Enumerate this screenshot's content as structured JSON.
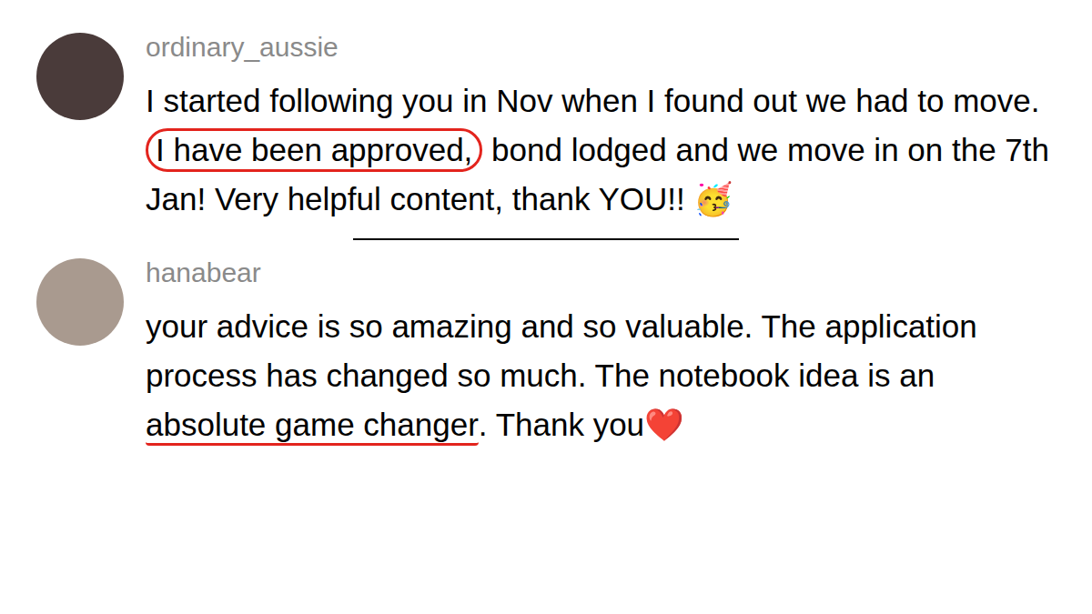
{
  "comments": [
    {
      "username": "ordinary_aussie",
      "segments": [
        {
          "text": "I started following you in Nov when I found out we had to move. ",
          "annotation": "none"
        },
        {
          "text": "I have been approved,",
          "annotation": "circle"
        },
        {
          "text": " bond lodged and we move in on the 7th Jan! Very helpful content, thank YOU!! 🥳",
          "annotation": "none"
        }
      ]
    },
    {
      "username": "hanabear",
      "segments": [
        {
          "text": "your advice is so amazing and so valuable. The application process has changed so much. The notebook idea is an ",
          "annotation": "none"
        },
        {
          "text": "absolute game changer",
          "annotation": "underline"
        },
        {
          "text": ". Thank you❤️",
          "annotation": "none"
        }
      ]
    }
  ]
}
